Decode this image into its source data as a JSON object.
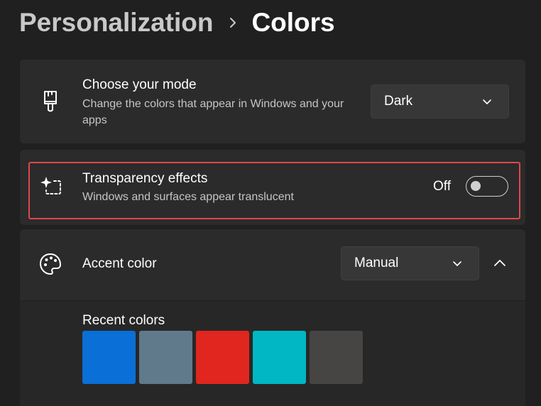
{
  "breadcrumb": {
    "parent": "Personalization",
    "separator_icon": "chevron-right-icon",
    "current": "Colors"
  },
  "mode": {
    "icon": "paintbrush-icon",
    "title": "Choose your mode",
    "description": "Change the colors that appear in Windows and your apps",
    "dropdown_value": "Dark"
  },
  "transparency": {
    "icon": "transparency-sparkle-icon",
    "title": "Transparency effects",
    "description": "Windows and surfaces appear translucent",
    "toggle_label": "Off",
    "toggle_on": false
  },
  "accent": {
    "icon": "palette-icon",
    "title": "Accent color",
    "dropdown_value": "Manual",
    "expand_icon": "chevron-up-icon"
  },
  "recent": {
    "label": "Recent colors",
    "swatches": [
      "#0a6fd6",
      "#607a8c",
      "#e0261e",
      "#00b7c3",
      "#474543"
    ]
  },
  "colors": {
    "background": "#202020",
    "card": "#2b2b2b",
    "highlight": "#e0474c"
  }
}
